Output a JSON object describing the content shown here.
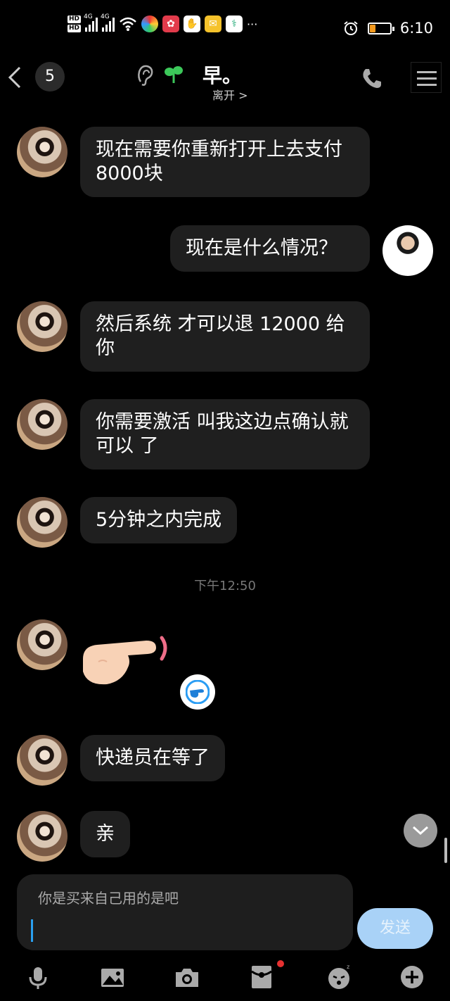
{
  "status_bar": {
    "hd1": "HD",
    "hd2": "HD",
    "net1": "4G",
    "net2": "4G",
    "more": "···",
    "time": "6:10",
    "icons": [
      "signal-icon",
      "wifi-icon",
      "app-icon",
      "app-icon",
      "app-icon",
      "app-icon",
      "app-icon",
      "alarm-icon",
      "battery-icon"
    ],
    "battery_level_percent": 15
  },
  "header": {
    "unread_count": "5",
    "title": "早。",
    "subtitle": "离开 >"
  },
  "messages": [
    {
      "sender": "other",
      "text": "现在需要你重新打开上去支付8000块"
    },
    {
      "sender": "me",
      "text": "现在是什么情况？"
    },
    {
      "sender": "other",
      "text": "然后系统 才可以退 12000 给你"
    },
    {
      "sender": "other",
      "text": "你需要激活 叫我这边点确认就可以 了"
    },
    {
      "sender": "other",
      "text": "5分钟之内完成"
    },
    {
      "sender": "other",
      "text": "快递员在等了"
    },
    {
      "sender": "other",
      "text": "亲"
    }
  ],
  "timestamp": "下午12:50",
  "input": {
    "text": "你是买来自己用的是吧",
    "send_label": "发送"
  },
  "colors": {
    "background": "#000000",
    "bubble": "#1f1f1f",
    "send_button": "#a9d2f7",
    "cursor": "#2aa0f0"
  }
}
